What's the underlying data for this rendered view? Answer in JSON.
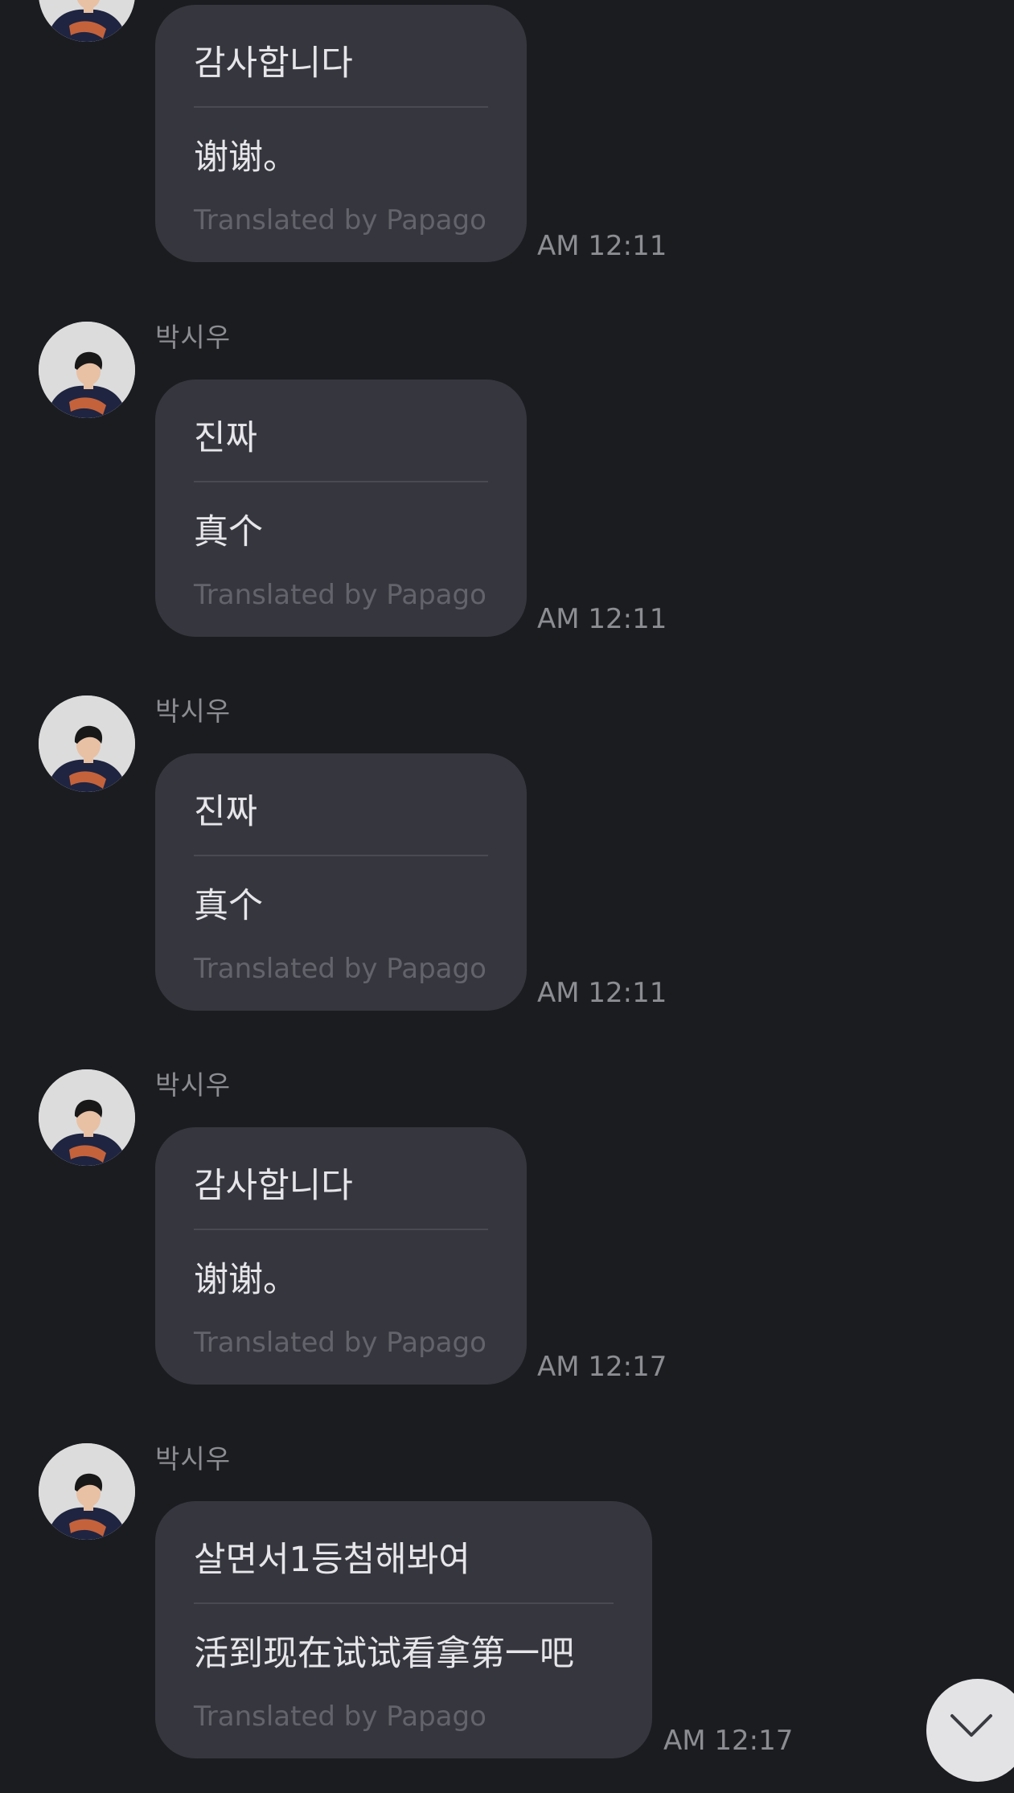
{
  "messages": [
    {
      "sender": "",
      "original": "감사합니다",
      "translation": "谢谢。",
      "credit": "Translated by Papago",
      "time": "AM 12:11"
    },
    {
      "sender": "박시우",
      "original": "진짜",
      "translation": "真个",
      "credit": "Translated by Papago",
      "time": "AM 12:11"
    },
    {
      "sender": "박시우",
      "original": "진짜",
      "translation": "真个",
      "credit": "Translated by Papago",
      "time": "AM 12:11"
    },
    {
      "sender": "박시우",
      "original": "감사합니다",
      "translation": "谢谢。",
      "credit": "Translated by Papago",
      "time": "AM 12:17"
    },
    {
      "sender": "박시우",
      "original": "살면서1등첨해봐여",
      "translation": "活到现在试试看拿第一吧",
      "credit": "Translated by Papago",
      "time": "AM 12:17"
    }
  ],
  "controls": {
    "scroll_down_icon": "chevron-down-icon"
  },
  "colors": {
    "background": "#1b1c20",
    "bubble": "#36373e",
    "text": "#e6e6ea",
    "secondary_text": "#8c8d92",
    "credit_text": "#63646b"
  }
}
